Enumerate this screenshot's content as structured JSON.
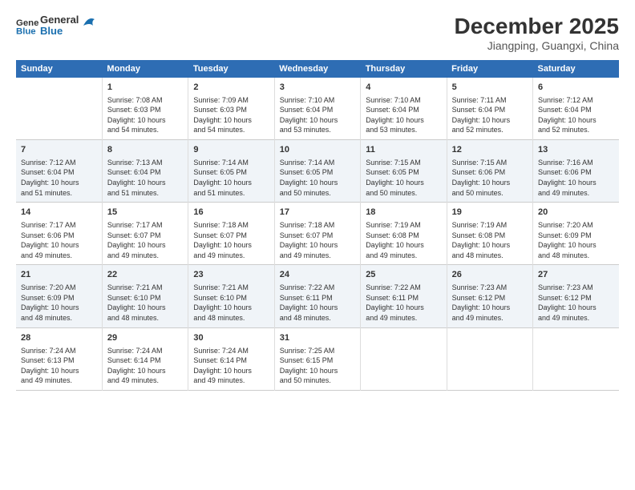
{
  "header": {
    "logo_line1": "General",
    "logo_line2": "Blue",
    "title": "December 2025",
    "subtitle": "Jiangping, Guangxi, China"
  },
  "days_of_week": [
    "Sunday",
    "Monday",
    "Tuesday",
    "Wednesday",
    "Thursday",
    "Friday",
    "Saturday"
  ],
  "weeks": [
    [
      {
        "day": "",
        "content": ""
      },
      {
        "day": "1",
        "content": "Sunrise: 7:08 AM\nSunset: 6:03 PM\nDaylight: 10 hours\nand 54 minutes."
      },
      {
        "day": "2",
        "content": "Sunrise: 7:09 AM\nSunset: 6:03 PM\nDaylight: 10 hours\nand 54 minutes."
      },
      {
        "day": "3",
        "content": "Sunrise: 7:10 AM\nSunset: 6:04 PM\nDaylight: 10 hours\nand 53 minutes."
      },
      {
        "day": "4",
        "content": "Sunrise: 7:10 AM\nSunset: 6:04 PM\nDaylight: 10 hours\nand 53 minutes."
      },
      {
        "day": "5",
        "content": "Sunrise: 7:11 AM\nSunset: 6:04 PM\nDaylight: 10 hours\nand 52 minutes."
      },
      {
        "day": "6",
        "content": "Sunrise: 7:12 AM\nSunset: 6:04 PM\nDaylight: 10 hours\nand 52 minutes."
      }
    ],
    [
      {
        "day": "7",
        "content": "Sunrise: 7:12 AM\nSunset: 6:04 PM\nDaylight: 10 hours\nand 51 minutes."
      },
      {
        "day": "8",
        "content": "Sunrise: 7:13 AM\nSunset: 6:04 PM\nDaylight: 10 hours\nand 51 minutes."
      },
      {
        "day": "9",
        "content": "Sunrise: 7:14 AM\nSunset: 6:05 PM\nDaylight: 10 hours\nand 51 minutes."
      },
      {
        "day": "10",
        "content": "Sunrise: 7:14 AM\nSunset: 6:05 PM\nDaylight: 10 hours\nand 50 minutes."
      },
      {
        "day": "11",
        "content": "Sunrise: 7:15 AM\nSunset: 6:05 PM\nDaylight: 10 hours\nand 50 minutes."
      },
      {
        "day": "12",
        "content": "Sunrise: 7:15 AM\nSunset: 6:06 PM\nDaylight: 10 hours\nand 50 minutes."
      },
      {
        "day": "13",
        "content": "Sunrise: 7:16 AM\nSunset: 6:06 PM\nDaylight: 10 hours\nand 49 minutes."
      }
    ],
    [
      {
        "day": "14",
        "content": "Sunrise: 7:17 AM\nSunset: 6:06 PM\nDaylight: 10 hours\nand 49 minutes."
      },
      {
        "day": "15",
        "content": "Sunrise: 7:17 AM\nSunset: 6:07 PM\nDaylight: 10 hours\nand 49 minutes."
      },
      {
        "day": "16",
        "content": "Sunrise: 7:18 AM\nSunset: 6:07 PM\nDaylight: 10 hours\nand 49 minutes."
      },
      {
        "day": "17",
        "content": "Sunrise: 7:18 AM\nSunset: 6:07 PM\nDaylight: 10 hours\nand 49 minutes."
      },
      {
        "day": "18",
        "content": "Sunrise: 7:19 AM\nSunset: 6:08 PM\nDaylight: 10 hours\nand 49 minutes."
      },
      {
        "day": "19",
        "content": "Sunrise: 7:19 AM\nSunset: 6:08 PM\nDaylight: 10 hours\nand 48 minutes."
      },
      {
        "day": "20",
        "content": "Sunrise: 7:20 AM\nSunset: 6:09 PM\nDaylight: 10 hours\nand 48 minutes."
      }
    ],
    [
      {
        "day": "21",
        "content": "Sunrise: 7:20 AM\nSunset: 6:09 PM\nDaylight: 10 hours\nand 48 minutes."
      },
      {
        "day": "22",
        "content": "Sunrise: 7:21 AM\nSunset: 6:10 PM\nDaylight: 10 hours\nand 48 minutes."
      },
      {
        "day": "23",
        "content": "Sunrise: 7:21 AM\nSunset: 6:10 PM\nDaylight: 10 hours\nand 48 minutes."
      },
      {
        "day": "24",
        "content": "Sunrise: 7:22 AM\nSunset: 6:11 PM\nDaylight: 10 hours\nand 48 minutes."
      },
      {
        "day": "25",
        "content": "Sunrise: 7:22 AM\nSunset: 6:11 PM\nDaylight: 10 hours\nand 49 minutes."
      },
      {
        "day": "26",
        "content": "Sunrise: 7:23 AM\nSunset: 6:12 PM\nDaylight: 10 hours\nand 49 minutes."
      },
      {
        "day": "27",
        "content": "Sunrise: 7:23 AM\nSunset: 6:12 PM\nDaylight: 10 hours\nand 49 minutes."
      }
    ],
    [
      {
        "day": "28",
        "content": "Sunrise: 7:24 AM\nSunset: 6:13 PM\nDaylight: 10 hours\nand 49 minutes."
      },
      {
        "day": "29",
        "content": "Sunrise: 7:24 AM\nSunset: 6:14 PM\nDaylight: 10 hours\nand 49 minutes."
      },
      {
        "day": "30",
        "content": "Sunrise: 7:24 AM\nSunset: 6:14 PM\nDaylight: 10 hours\nand 49 minutes."
      },
      {
        "day": "31",
        "content": "Sunrise: 7:25 AM\nSunset: 6:15 PM\nDaylight: 10 hours\nand 50 minutes."
      },
      {
        "day": "",
        "content": ""
      },
      {
        "day": "",
        "content": ""
      },
      {
        "day": "",
        "content": ""
      }
    ]
  ]
}
